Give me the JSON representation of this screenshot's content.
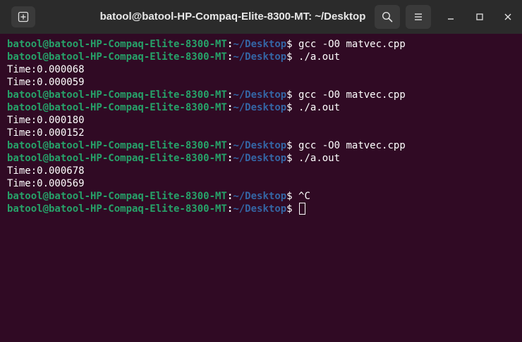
{
  "window": {
    "title": "batool@batool-HP-Compaq-Elite-8300-MT: ~/Desktop"
  },
  "prompt": {
    "user_host": "batool@batool-HP-Compaq-Elite-8300-MT",
    "colon": ":",
    "path": "~/Desktop",
    "dollar": "$"
  },
  "lines": [
    {
      "type": "prompt",
      "cmd": " gcc -O0 matvec.cpp"
    },
    {
      "type": "prompt",
      "cmd": " ./a.out"
    },
    {
      "type": "output",
      "text": "Time:0.000068"
    },
    {
      "type": "output",
      "text": "Time:0.000059"
    },
    {
      "type": "prompt",
      "cmd": " gcc -O0 matvec.cpp"
    },
    {
      "type": "prompt",
      "cmd": " ./a.out"
    },
    {
      "type": "output",
      "text": "Time:0.000180"
    },
    {
      "type": "output",
      "text": "Time:0.000152"
    },
    {
      "type": "prompt",
      "cmd": " gcc -O0 matvec.cpp"
    },
    {
      "type": "prompt",
      "cmd": " ./a.out"
    },
    {
      "type": "output",
      "text": "Time:0.000678"
    },
    {
      "type": "output",
      "text": "Time:0.000569"
    },
    {
      "type": "prompt",
      "cmd": " ^C"
    },
    {
      "type": "prompt",
      "cmd": " ",
      "cursor": true
    }
  ],
  "icons": {
    "new_tab": "new-tab-icon",
    "search": "search-icon",
    "menu": "hamburger-menu-icon",
    "minimize": "minimize-icon",
    "maximize": "maximize-icon",
    "close": "close-icon"
  },
  "colors": {
    "terminal_bg": "#300a24",
    "user_host": "#26a269",
    "path": "#3465a4",
    "titlebar_bg": "#2b2b2b"
  }
}
